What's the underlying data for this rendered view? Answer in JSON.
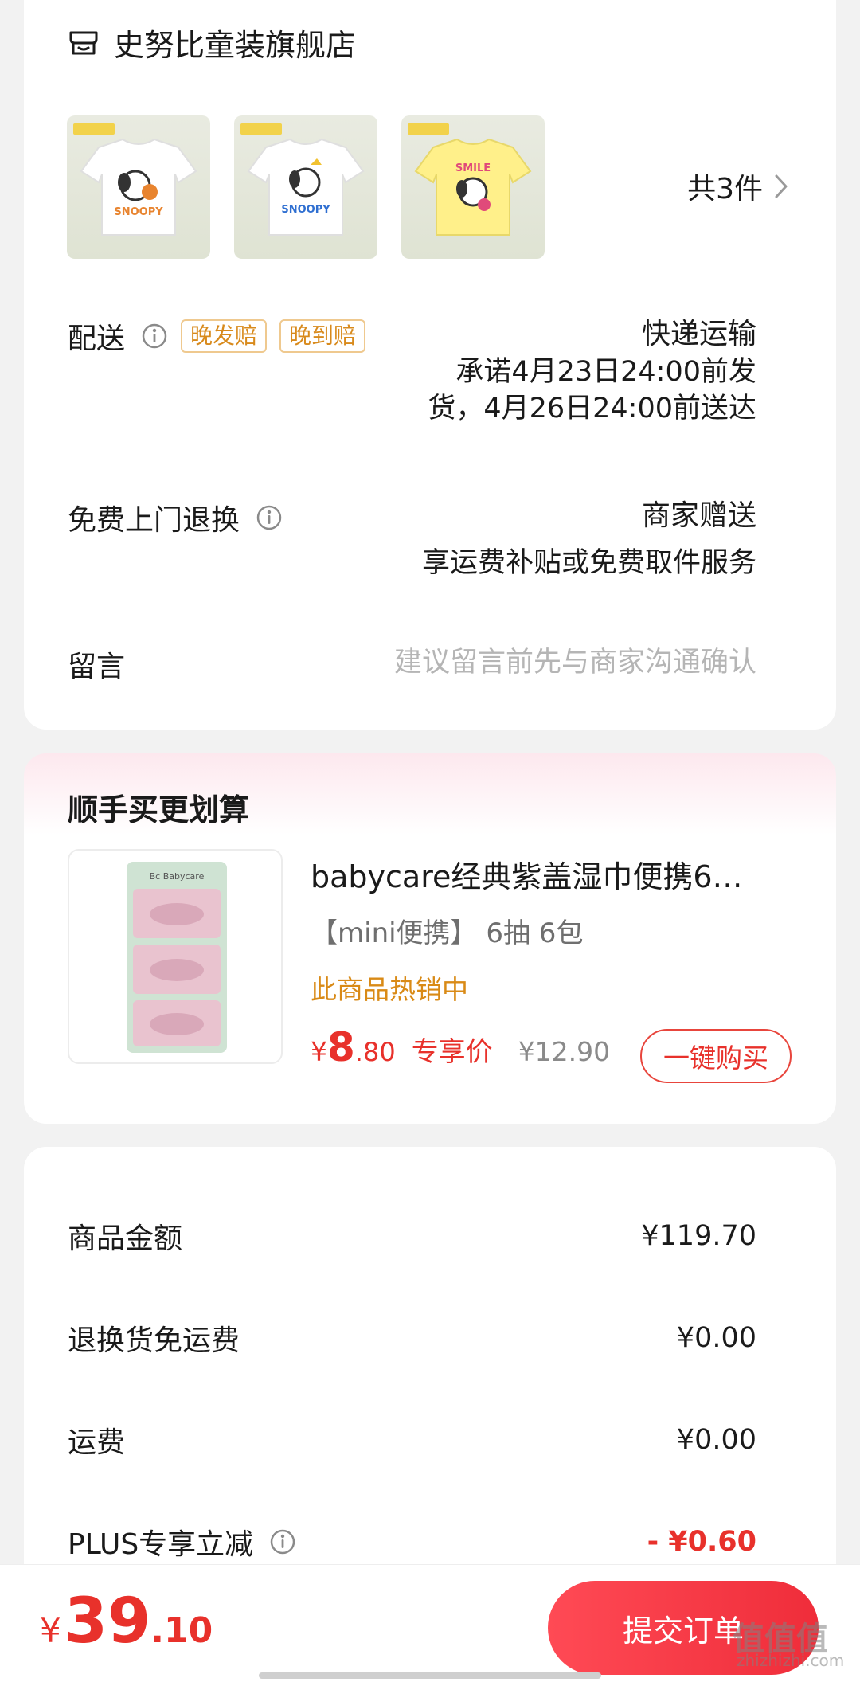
{
  "store": {
    "name": "史努比童装旗舰店",
    "item_count": "共3件"
  },
  "products": [
    {
      "logo": "SNOOPY",
      "label": "SNOOPY",
      "shirt_color": "#ffffff"
    },
    {
      "logo": "SNOOPY",
      "label": "SNOOPY",
      "shirt_color": "#ffffff"
    },
    {
      "logo": "SNOOPY",
      "label": "SMILE",
      "shirt_color": "#fff08a"
    }
  ],
  "delivery": {
    "label": "配送",
    "tags": [
      "晚发赔",
      "晚到赔"
    ],
    "method": "快递运输",
    "promise_line1": "承诺4月23日24:00前发",
    "promise_line2": "货，4月26日24:00前送达"
  },
  "return": {
    "label": "免费上门退换",
    "value": "商家赠送",
    "desc": "享运费补贴或免费取件服务"
  },
  "message": {
    "label": "留言",
    "placeholder": "建议留言前先与商家沟通确认"
  },
  "promo": {
    "title": "顺手买更划算",
    "product_name": "babycare经典紫盖湿巾便携6…",
    "spec": "【mini便携】 6抽 6包",
    "hot": "此商品热销中",
    "price_symbol": "¥",
    "price_int": "8",
    "price_dec": ".80",
    "price_label": "专享价",
    "old_price": "¥12.90",
    "buy_label": "一键购买",
    "brand": "Bc Babycare"
  },
  "amounts": [
    {
      "label": "商品金额",
      "value": "¥119.70"
    },
    {
      "label": "退换货免运费",
      "value": "¥0.00"
    },
    {
      "label": "运费",
      "value": "¥0.00"
    },
    {
      "label": "PLUS专享立减",
      "value": "- ¥0.60"
    }
  ],
  "footer": {
    "total_symbol": "¥",
    "total_int": "39",
    "total_dec": ".10",
    "submit_label": "提交订单",
    "watermark": "值值值",
    "watermark_url": "zhizhizhi.com"
  },
  "colors": {
    "accent": "#e8312b",
    "tag": "#d88a1c",
    "hot": "#d98a16"
  }
}
